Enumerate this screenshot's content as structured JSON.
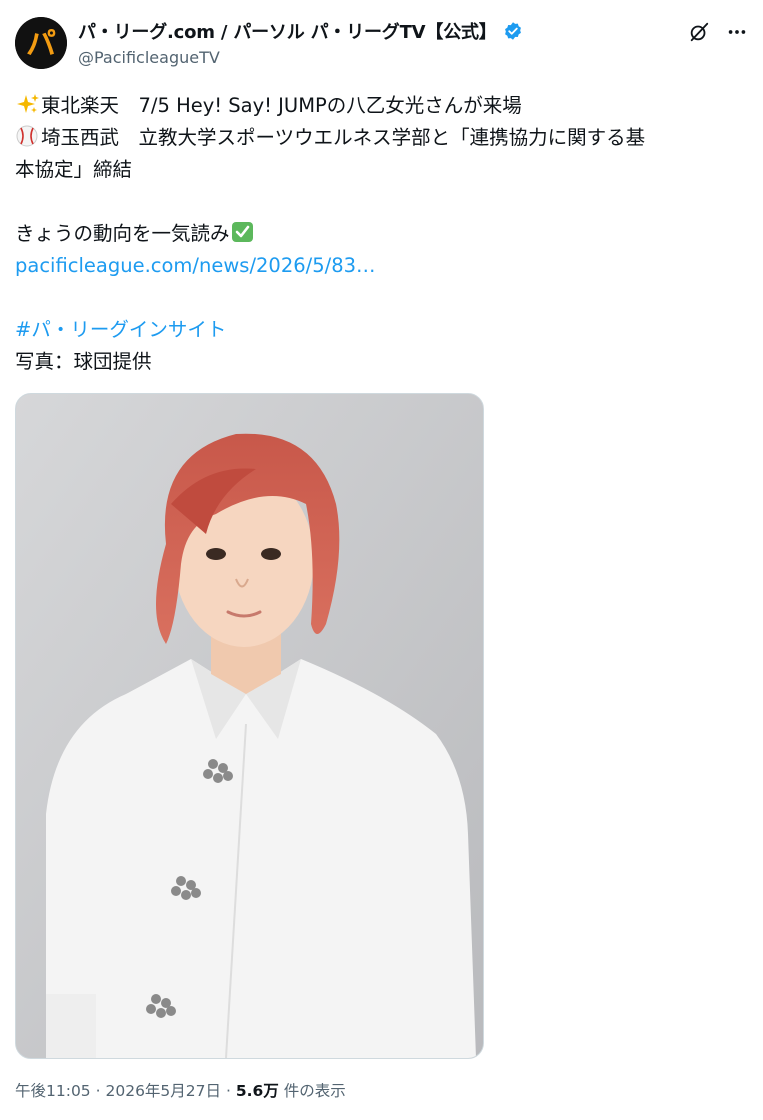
{
  "author": {
    "display_name": "パ・リーグ.com / パーソル パ・リーグTV【公式】",
    "handle": "@PacificleagueTV",
    "avatar_text": "パ",
    "avatar_color": "#f39c12",
    "verified_color": "#1d9bf0"
  },
  "actions": {
    "grok_icon": "grok-icon",
    "more_icon": "more-icon"
  },
  "tweet": {
    "line1": "東北楽天　7/5 Hey! Say! JUMPの八乙女光さんが来場",
    "line2": "埼玉西武　立教大学スポーツウエルネス学部と「連携協力に関する基",
    "line3": "本協定」締結",
    "line4": "きょうの動向を一気読み",
    "link": "pacificleague.com/news/2026/5/83…",
    "hashtag": "#パ・リーグインサイト",
    "credit": "写真：球団提供"
  },
  "meta": {
    "time": "午後11:05",
    "separator": "·",
    "date": "2026年5月27日",
    "views_count": "5.6万",
    "views_label": "件の表示"
  }
}
